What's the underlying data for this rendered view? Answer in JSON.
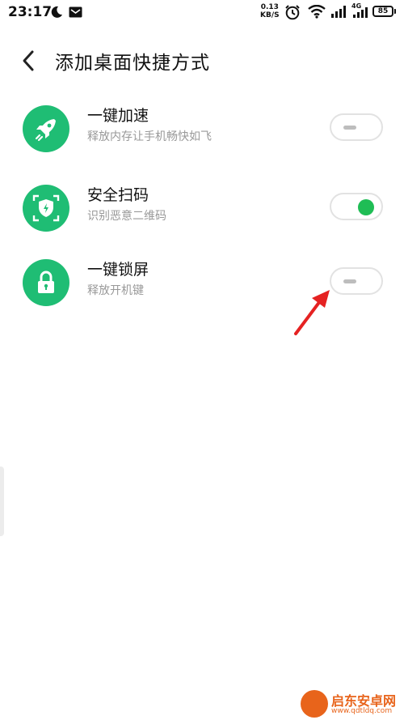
{
  "status_bar": {
    "time": "23:17",
    "net_speed_value": "0.13",
    "net_speed_unit": "KB/S",
    "net_type": "4G",
    "battery": "85"
  },
  "header": {
    "title": "添加桌面快捷方式"
  },
  "items": [
    {
      "title": "一键加速",
      "subtitle": "释放内存让手机畅快如飞",
      "icon": "rocket-icon",
      "enabled": false
    },
    {
      "title": "安全扫码",
      "subtitle": "识别恶意二维码",
      "icon": "shield-scan-icon",
      "enabled": true
    },
    {
      "title": "一键锁屏",
      "subtitle": "释放开机键",
      "icon": "lock-icon",
      "enabled": false
    }
  ],
  "colors": {
    "accent": "#1fbd74",
    "toggle_on": "#1fbd55",
    "annotation_arrow": "#e52222",
    "watermark": "#e8641b"
  },
  "watermark": {
    "name": "启东安卓网",
    "url": "www.qdtldq.com"
  }
}
